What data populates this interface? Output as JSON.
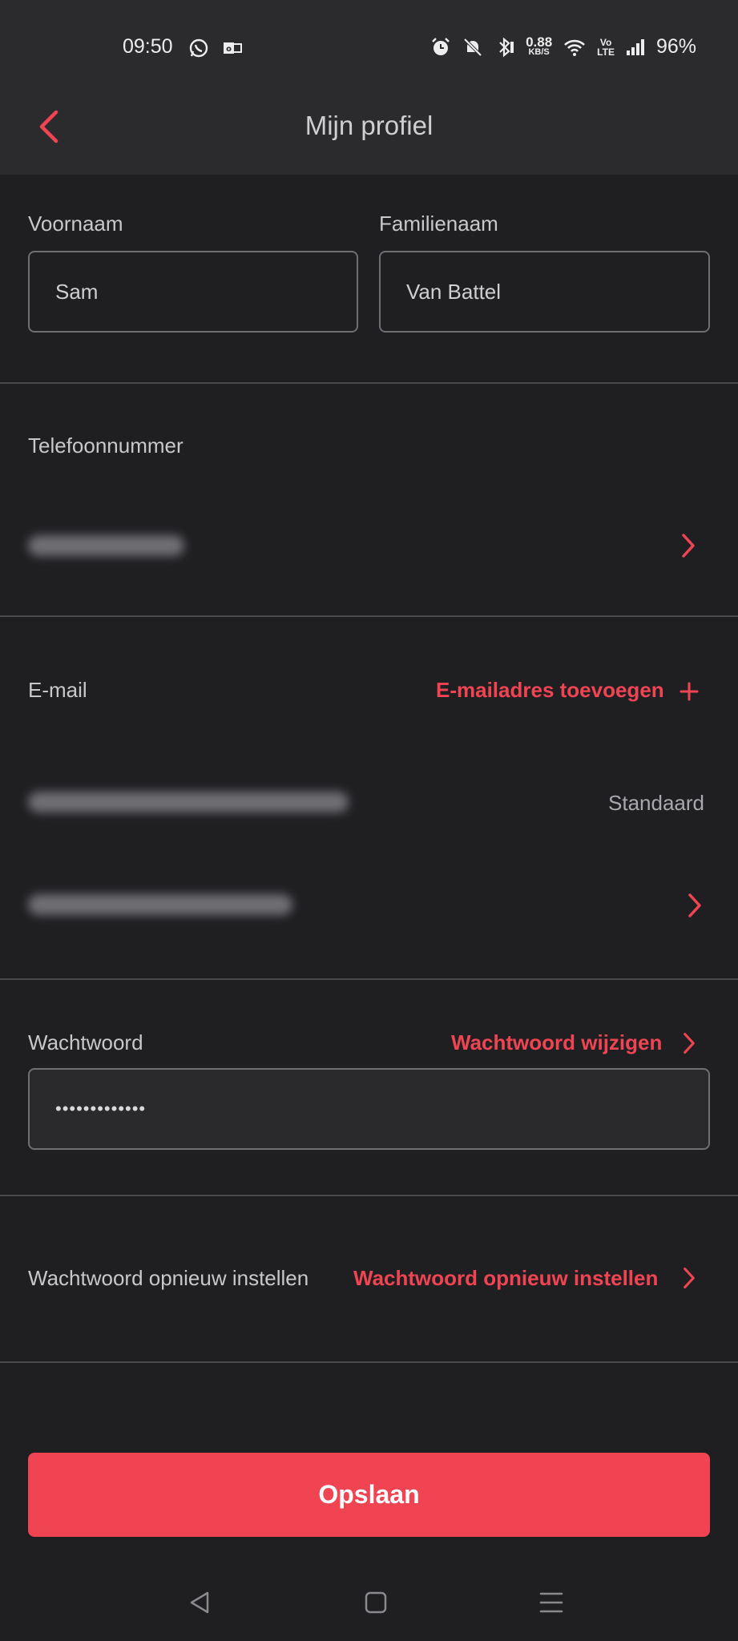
{
  "status_bar": {
    "time": "09:50",
    "speed_value": "0.88",
    "speed_unit": "KB/S",
    "volte_top": "Vo",
    "volte_bottom": "LTE",
    "battery": "96%",
    "icons": [
      "whatsapp-icon",
      "outlook-icon",
      "alarm-icon",
      "mute-bell-icon",
      "bluetooth-icon",
      "wifi-icon",
      "signal-icon"
    ]
  },
  "header": {
    "title": "Mijn profiel"
  },
  "name": {
    "first_label": "Voornaam",
    "first_value": "Sam",
    "last_label": "Familienaam",
    "last_value": "Van Battel"
  },
  "phone": {
    "label": "Telefoonnummer"
  },
  "email": {
    "label": "E-mail",
    "add_label": "E-mailadres toevoegen",
    "default_label": "Standaard"
  },
  "password": {
    "label": "Wachtwoord",
    "change_label": "Wachtwoord wijzigen",
    "masked_value": "•••••••••••••"
  },
  "reset": {
    "label": "Wachtwoord opnieuw instellen",
    "link_label": "Wachtwoord opnieuw instellen"
  },
  "actions": {
    "save_label": "Opslaan"
  },
  "colors": {
    "accent": "#f04452",
    "background": "#1f1f22",
    "header": "#2b2b2e"
  }
}
